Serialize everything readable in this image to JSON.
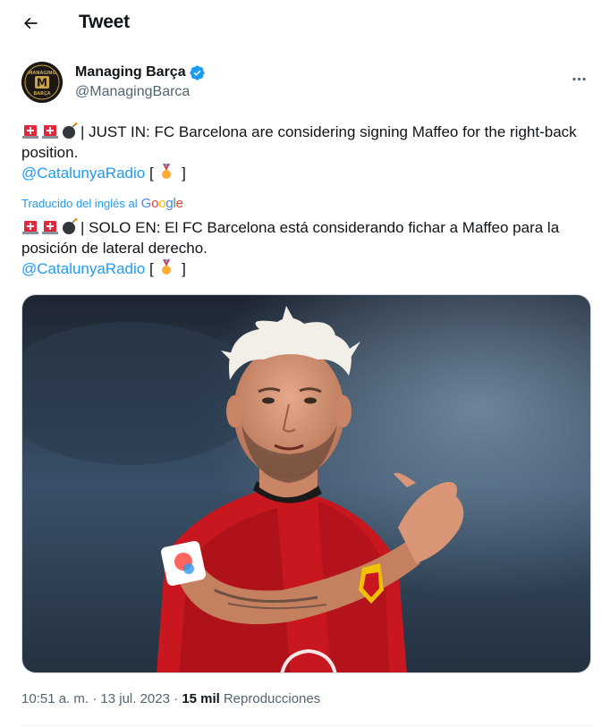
{
  "topbar": {
    "title": "Tweet",
    "back_icon": "arrow-left-icon"
  },
  "author": {
    "display_name": "Managing Barça",
    "handle": "@ManagingBarca",
    "verified_icon": "verified-badge-icon",
    "avatar_text_top": "MANAGING",
    "avatar_letter": "M",
    "avatar_text_bottom": "BARÇA"
  },
  "tweet": {
    "original_text": "| JUST IN: FC Barcelona are considering signing Maffeo for the right-back position.",
    "original_mention": "@CatalunyaRadio",
    "translated_label": "Traducido del inglés al",
    "translated_brand": "Google",
    "translated_text": "| SOLO EN: El FC Barcelona está considerando fichar a Maffeo para la posición de lateral derecho.",
    "translated_mention": "@CatalunyaRadio",
    "bracket_open": "[",
    "bracket_close": "]",
    "emojis": [
      "police-light-icon",
      "police-light-icon",
      "bomb-icon"
    ],
    "medal_icon": "medal-icon"
  },
  "meta": {
    "time": "10:51 a. m.",
    "sep1": "·",
    "date": "13 jul. 2023",
    "sep2": "·",
    "views_count": "15 mil",
    "views_label": "Reproducciones"
  },
  "colors": {
    "accent": "#1d9bf0",
    "text": "#0f1419",
    "secondary": "#536471"
  }
}
